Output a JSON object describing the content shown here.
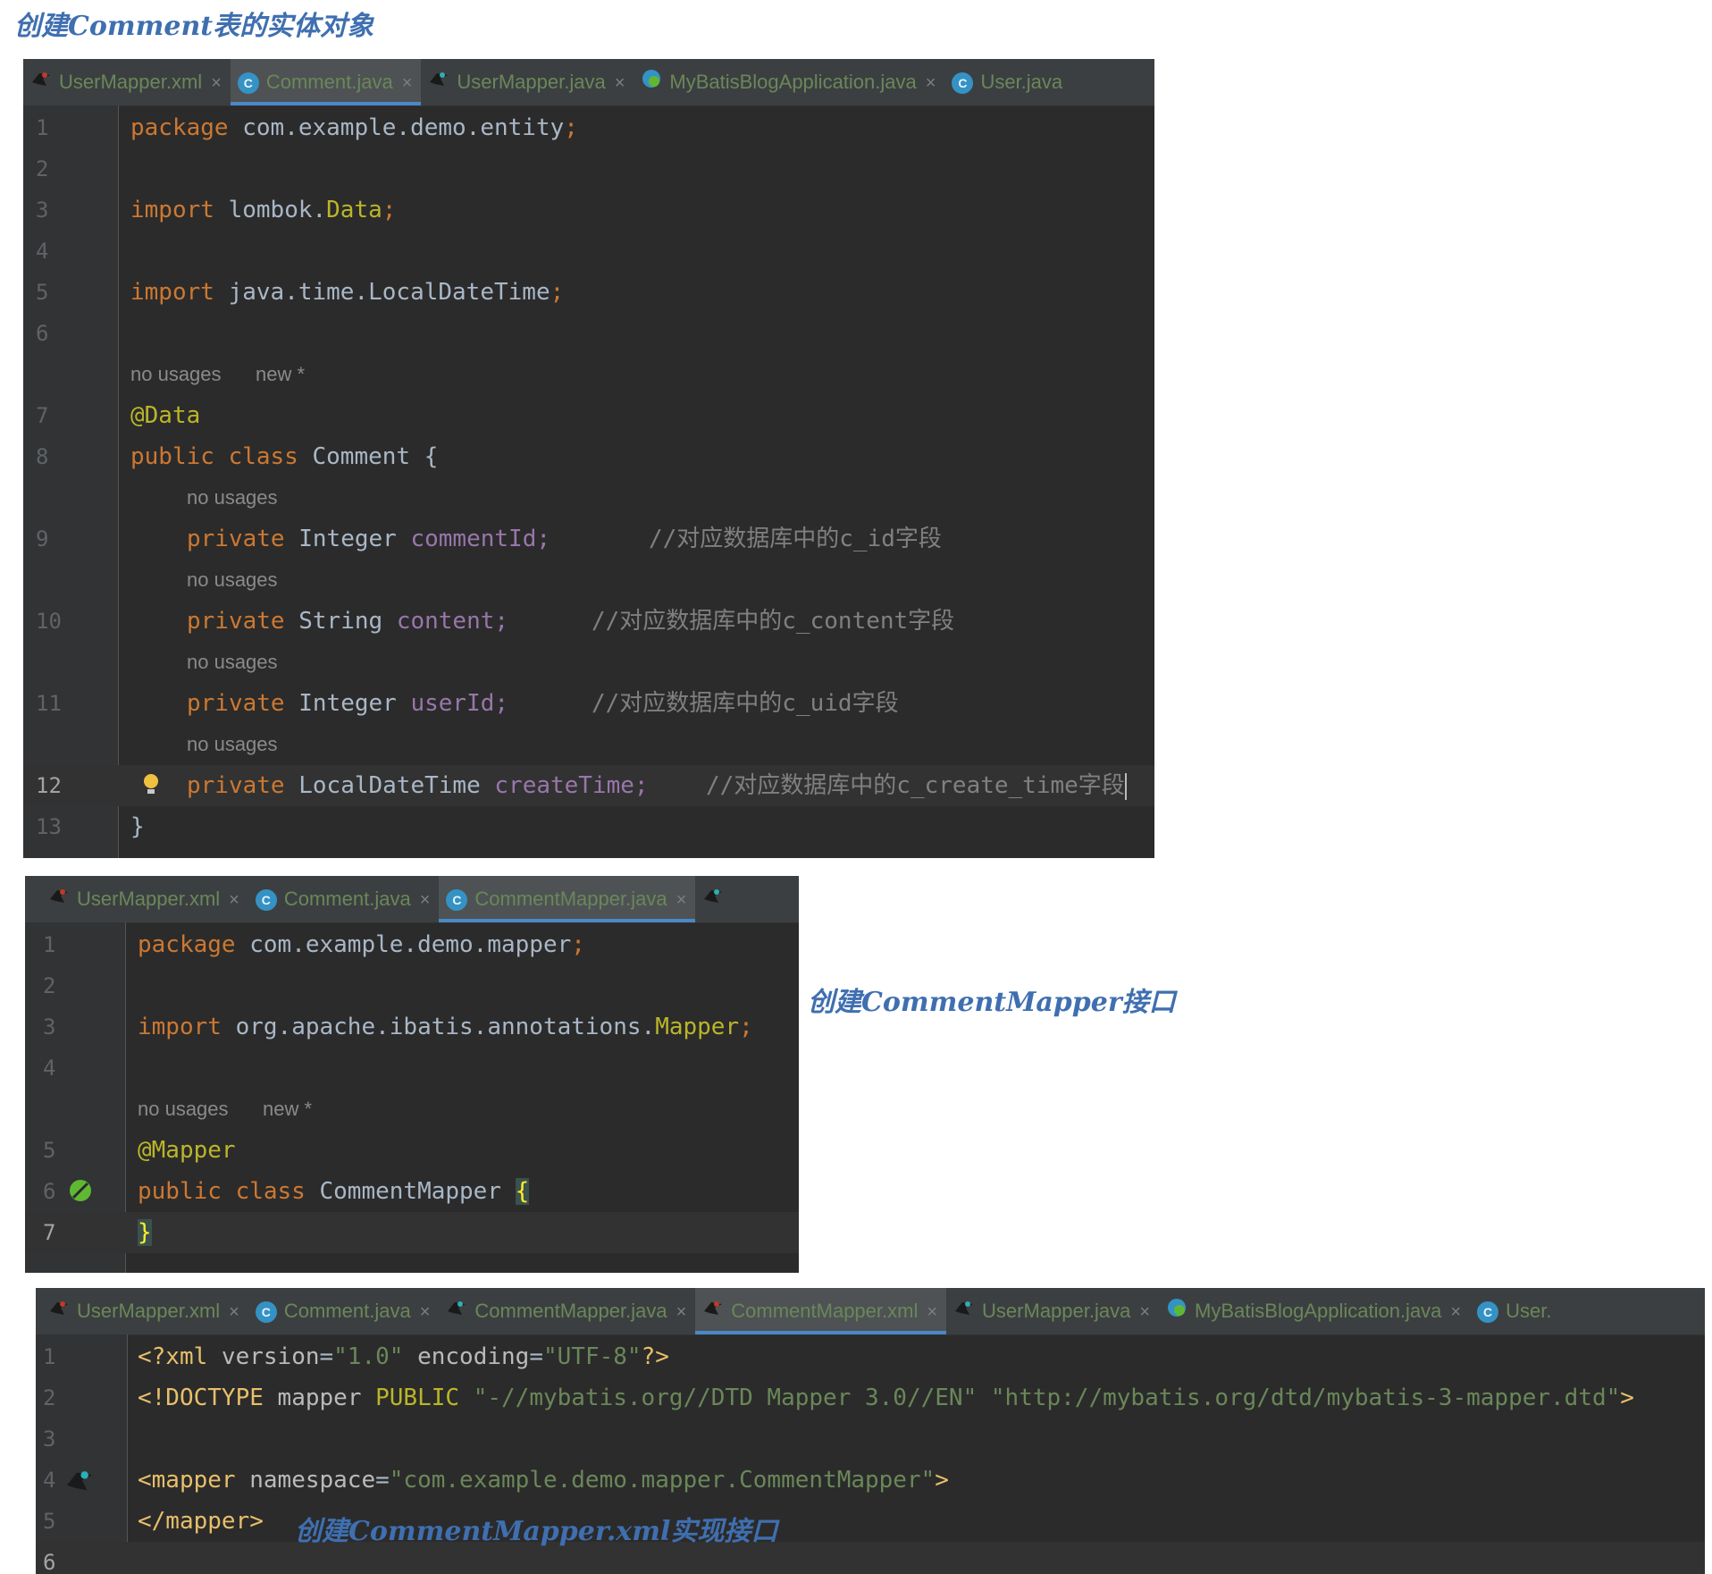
{
  "captions": {
    "entity": "创建Comment表的实体对象",
    "mapper": "创建CommentMapper接口",
    "xml": "创建CommentMapper.xml实现接口"
  },
  "colors": {
    "background": "#2b2b2b",
    "keyword": "#cc7832",
    "annotation": "#bbb529",
    "field": "#9876aa",
    "comment": "#808080",
    "string": "#6a8759",
    "caption": "#3f6fb0"
  },
  "icons": {
    "java_class": "C",
    "mybatis": "mybatis-bird-icon",
    "spring": "spring-leaf-icon",
    "bulb": "intention-bulb-icon",
    "close": "×"
  },
  "editor1": {
    "tabs": [
      "UserMapper.xml",
      "Comment.java",
      "UserMapper.java",
      "MyBatisBlogApplication.java",
      "User.java"
    ],
    "active_tab": "Comment.java",
    "hint_no_usages": "no usages",
    "hint_new": "new *",
    "lines": {
      "l1": {
        "num": "1",
        "kw": "package",
        "rest": " com.example.demo.entity",
        "semi": ";"
      },
      "l3": {
        "num": "3",
        "kw": "import",
        "rest": " lombok.",
        "cls": "Data",
        "semi": ";"
      },
      "l5": {
        "num": "5",
        "kw": "import",
        "rest": " java.time.LocalDateTime",
        "semi": ";"
      },
      "l7": {
        "num": "7",
        "anno": "@Data"
      },
      "l8": {
        "num": "8",
        "kw": "public class",
        "rest": " Comment {"
      },
      "l9": {
        "num": "9",
        "kw": "private",
        "type": " Integer ",
        "field": "commentId;",
        "comment": "//对应数据库中的c_id字段"
      },
      "l10": {
        "num": "10",
        "kw": "private",
        "type": " String ",
        "field": "content;",
        "comment": "//对应数据库中的c_content字段"
      },
      "l11": {
        "num": "11",
        "kw": "private",
        "type": " Integer ",
        "field": "userId;",
        "comment": "//对应数据库中的c_uid字段"
      },
      "l12": {
        "num": "12",
        "kw": "private",
        "type": " LocalDateTime ",
        "field": "createTime;",
        "comment": "//对应数据库中的c_create_time字段"
      },
      "l13": {
        "num": "13",
        "text": "}"
      }
    },
    "blank_nums": [
      "2",
      "4",
      "6"
    ]
  },
  "editor2": {
    "tabs": [
      "UserMapper.xml",
      "Comment.java",
      "CommentMapper.java"
    ],
    "active_tab": "CommentMapper.java",
    "hint_no_usages": "no usages",
    "hint_new": "new *",
    "lines": {
      "l1": {
        "num": "1",
        "kw": "package",
        "rest": " com.example.demo.mapper",
        "semi": ";"
      },
      "l3": {
        "num": "3",
        "kw": "import",
        "rest": " org.apache.ibatis.annotations.",
        "cls": "Mapper",
        "semi": ";"
      },
      "l5": {
        "num": "5",
        "anno": "@Mapper"
      },
      "l6": {
        "num": "6",
        "kw": "public class",
        "rest": " CommentMapper ",
        "brace": "{"
      },
      "l7": {
        "num": "7",
        "brace": "}"
      }
    },
    "blank_nums": [
      "2",
      "4"
    ]
  },
  "editor3": {
    "tabs": [
      "UserMapper.xml",
      "Comment.java",
      "CommentMapper.java",
      "CommentMapper.xml",
      "UserMapper.java",
      "MyBatisBlogApplication.java",
      "User."
    ],
    "active_tab": "CommentMapper.xml",
    "lines": {
      "l1": {
        "num": "1",
        "a": "<?xml ",
        "b": "version",
        "c": "=",
        "d": "\"1.0\"",
        "e": " encoding",
        "f": "=",
        "g": "\"UTF-8\"",
        "h": "?>"
      },
      "l2": {
        "num": "2",
        "a": "<!DOCTYPE ",
        "b": "mapper ",
        "c": "PUBLIC ",
        "d": "\"-//mybatis.org//DTD Mapper 3.0//EN\"",
        "e": " ",
        "f": "\"http://mybatis.org/dtd/mybatis-3-mapper.dtd\"",
        "g": ">"
      },
      "l4": {
        "num": "4",
        "a": "<mapper ",
        "b": "namespace",
        "c": "=",
        "d": "\"com.example.demo.mapper.CommentMapper\"",
        "e": ">"
      },
      "l5": {
        "num": "5",
        "a": "</mapper>"
      }
    },
    "blank_nums": [
      "3",
      "6"
    ]
  }
}
